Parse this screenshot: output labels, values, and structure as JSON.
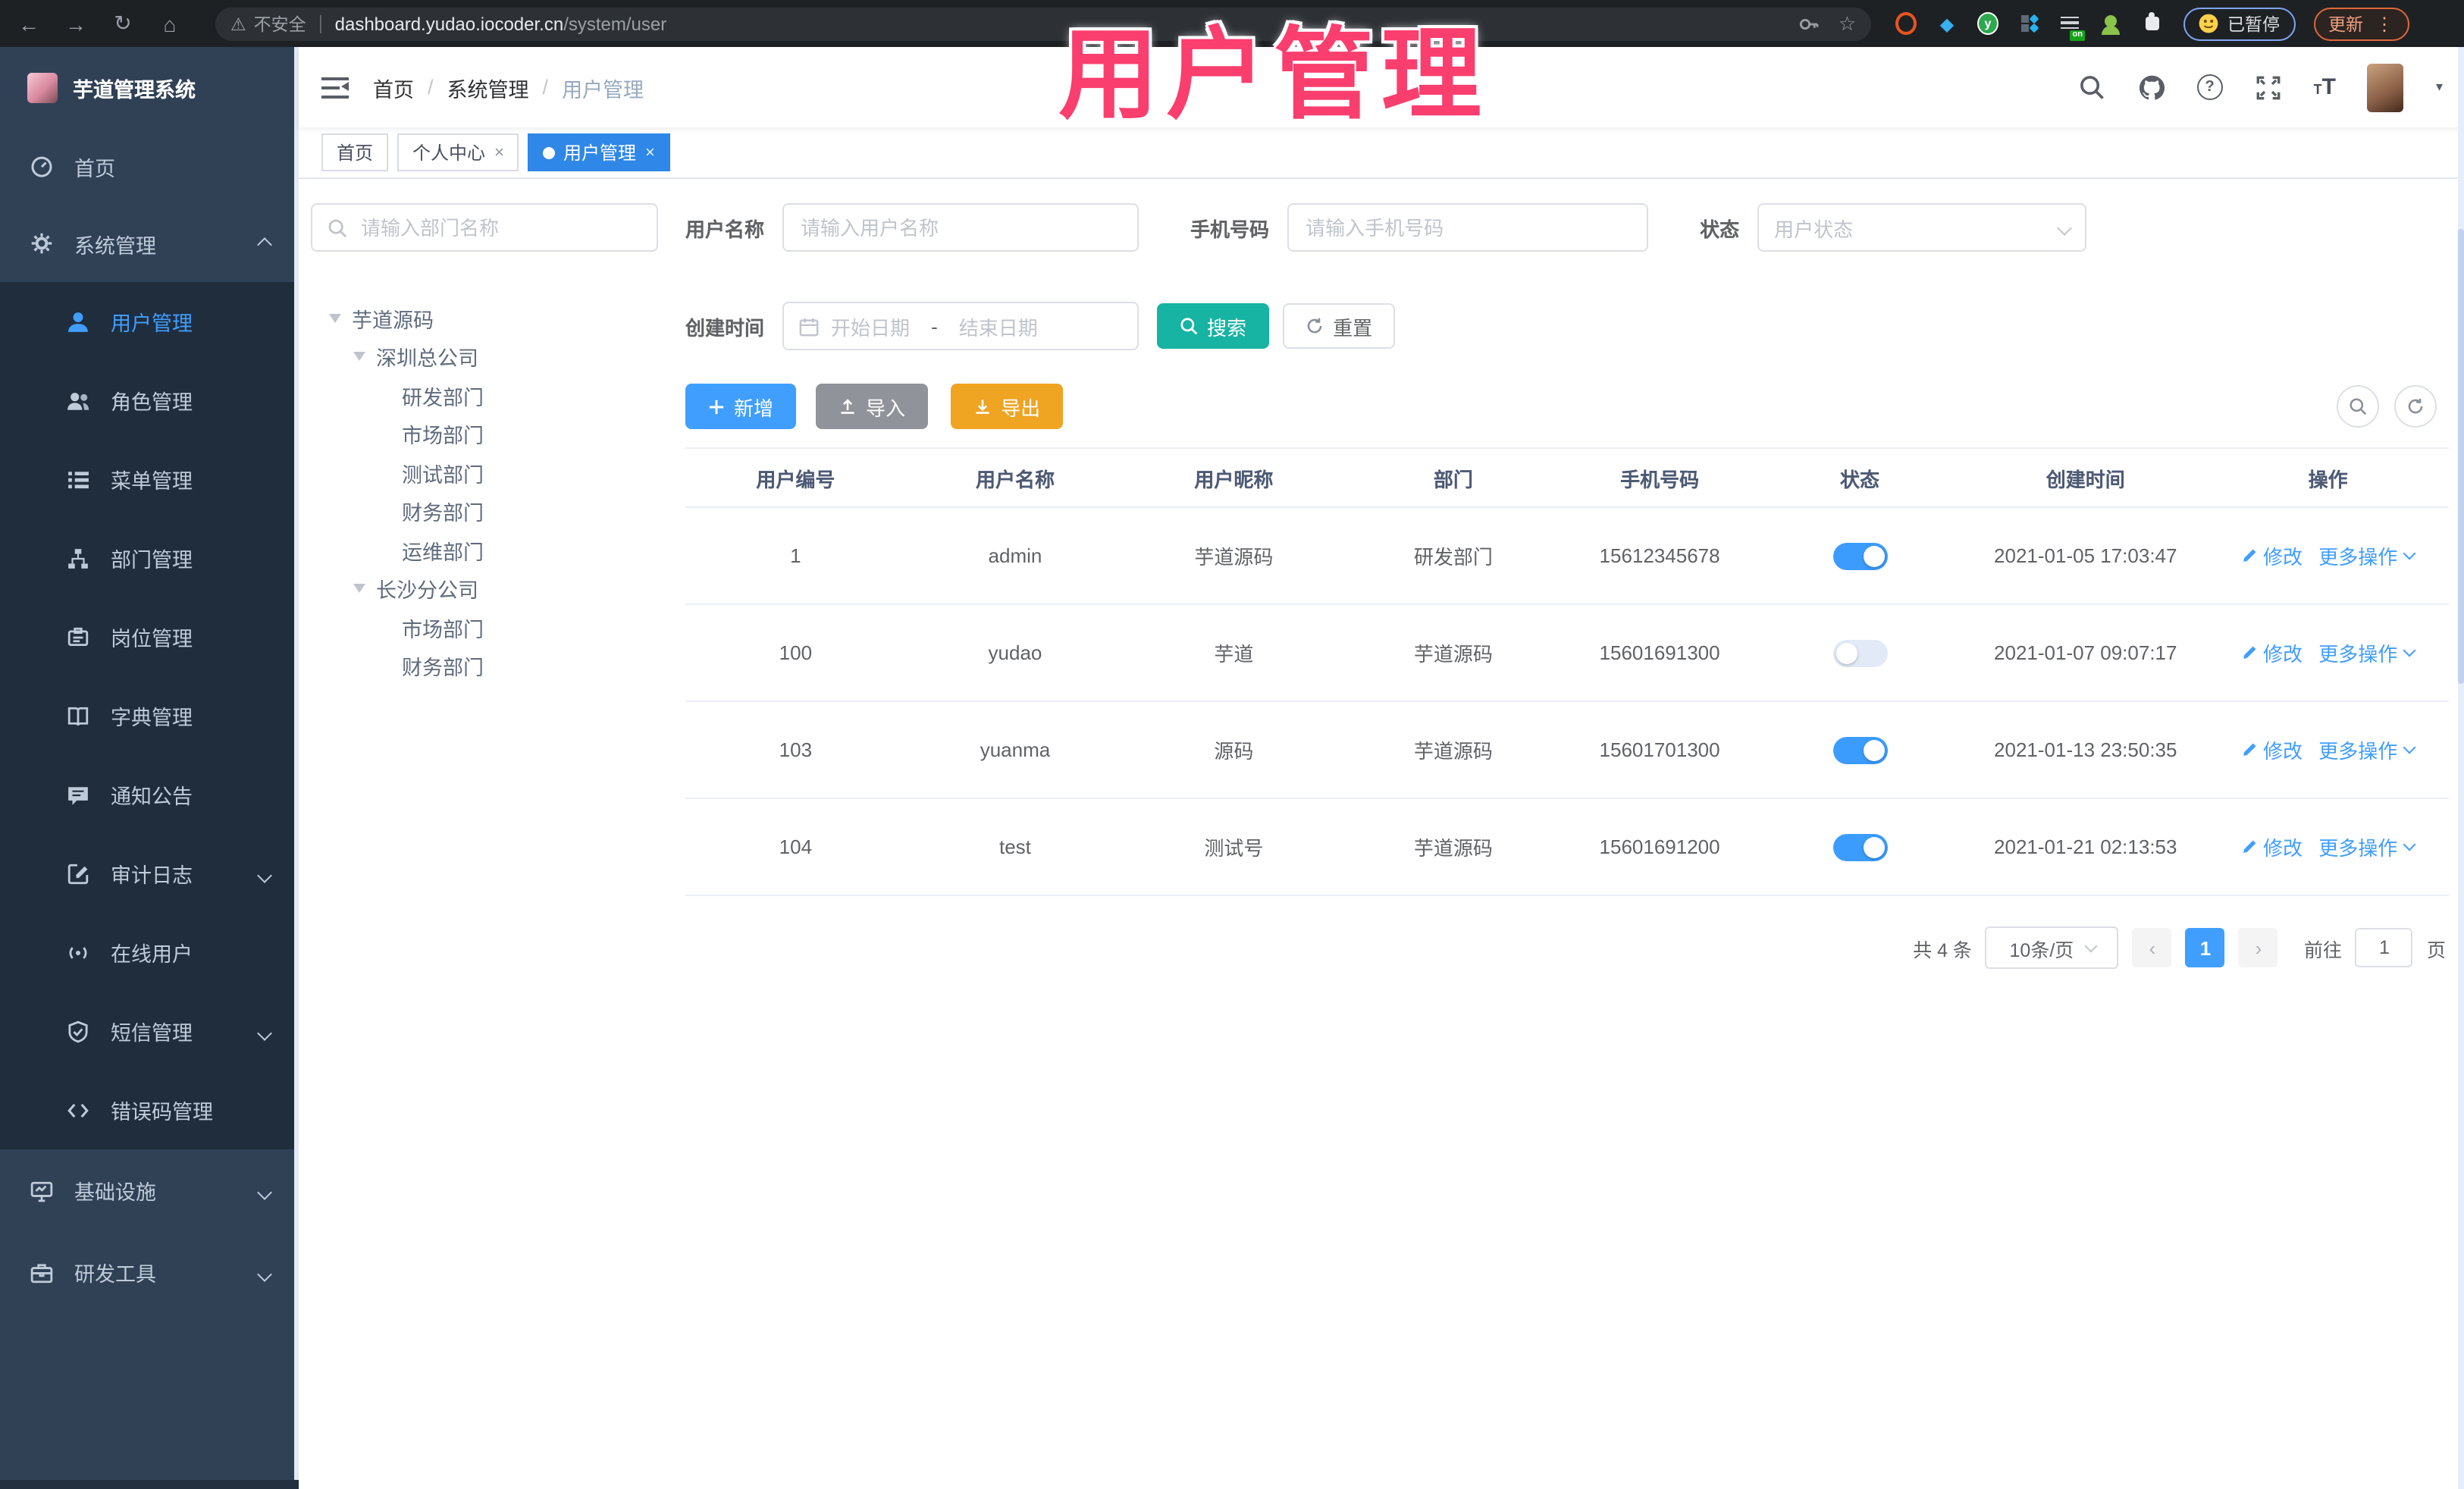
{
  "browser": {
    "back": "←",
    "forward": "→",
    "reload": "↻",
    "home": "⌂",
    "warning": "⚠",
    "security_label": "不安全",
    "url_host": "dashboard.yudao.iocoder.cn",
    "url_path": "/system/user",
    "star": "☆",
    "ext_y_label": "y",
    "ext_on_badge": "on",
    "paused_label": "已暂停",
    "update_label": "更新",
    "menu_dots": "⋮",
    "gem": "◆"
  },
  "annotation": {
    "text": "用户管理"
  },
  "sidebar": {
    "logo_title": "芋道管理系统",
    "top_items": [
      {
        "label": "首页"
      },
      {
        "label": "系统管理"
      }
    ],
    "submenu": [
      {
        "label": "用户管理"
      },
      {
        "label": "角色管理"
      },
      {
        "label": "菜单管理"
      },
      {
        "label": "部门管理"
      },
      {
        "label": "岗位管理"
      },
      {
        "label": "字典管理"
      },
      {
        "label": "通知公告"
      },
      {
        "label": "审计日志"
      },
      {
        "label": "在线用户"
      },
      {
        "label": "短信管理"
      },
      {
        "label": "错误码管理"
      }
    ],
    "bottom_items": [
      {
        "label": "基础设施"
      },
      {
        "label": "研发工具"
      }
    ]
  },
  "breadcrumb": {
    "sep": "/",
    "items": [
      "首页",
      "系统管理",
      "用户管理"
    ]
  },
  "header": {
    "question": "?",
    "caret": "▾"
  },
  "tabs": [
    {
      "label": "首页"
    },
    {
      "label": "个人中心",
      "close": "×"
    },
    {
      "label": "用户管理",
      "close": "×"
    }
  ],
  "tree": {
    "search_placeholder": "请输入部门名称",
    "nodes": [
      "芋道源码",
      "深圳总公司",
      "研发部门",
      "市场部门",
      "测试部门",
      "财务部门",
      "运维部门",
      "长沙分公司",
      "市场部门",
      "财务部门"
    ]
  },
  "filters": {
    "username_label": "用户名称",
    "username_placeholder": "请输入用户名称",
    "mobile_label": "手机号码",
    "mobile_placeholder": "请输入手机号码",
    "status_label": "状态",
    "status_placeholder": "用户状态",
    "time_label": "创建时间",
    "date_start": "开始日期",
    "date_sep": "-",
    "date_end": "结束日期",
    "search_label": "搜索",
    "reset_label": "重置"
  },
  "toolbar": {
    "add_label": "新增",
    "import_label": "导入",
    "export_label": "导出"
  },
  "table": {
    "headers": [
      "用户编号",
      "用户名称",
      "用户昵称",
      "部门",
      "手机号码",
      "状态",
      "创建时间",
      "操作"
    ],
    "action_edit": "修改",
    "action_more": "更多操作",
    "rows": [
      {
        "id": "1",
        "username": "admin",
        "nickname": "芋道源码",
        "dept": "研发部门",
        "mobile": "15612345678",
        "status_on": true,
        "created": "2021-01-05 17:03:47"
      },
      {
        "id": "100",
        "username": "yudao",
        "nickname": "芋道",
        "dept": "芋道源码",
        "mobile": "15601691300",
        "status_on": false,
        "created": "2021-01-07 09:07:17"
      },
      {
        "id": "103",
        "username": "yuanma",
        "nickname": "源码",
        "dept": "芋道源码",
        "mobile": "15601701300",
        "status_on": true,
        "created": "2021-01-13 23:50:35"
      },
      {
        "id": "104",
        "username": "test",
        "nickname": "测试号",
        "dept": "芋道源码",
        "mobile": "15601691200",
        "status_on": true,
        "created": "2021-01-21 02:13:53"
      }
    ]
  },
  "pagination": {
    "total": "共 4 条",
    "page_size": "10条/页",
    "prev": "‹",
    "page": "1",
    "next": "›",
    "goto_label": "前往",
    "goto_value": "1",
    "page_unit": "页"
  }
}
